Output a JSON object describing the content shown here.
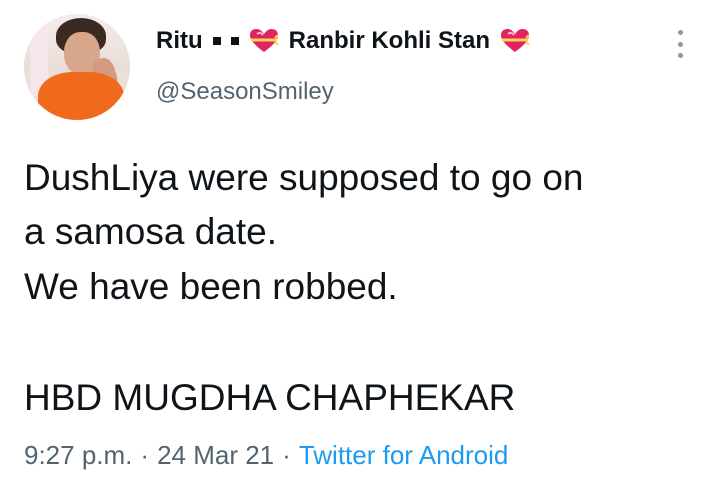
{
  "user": {
    "name_first": "Ritu",
    "name_second": "Ranbir Kohli Stan",
    "handle": "@SeasonSmiley"
  },
  "tweet": {
    "lines": [
      "DushLiya were supposed to go on",
      "a samosa date.",
      "We have been robbed.",
      "HBD MUGDHA CHAPHEKAR"
    ]
  },
  "meta": {
    "time": "9:27 p.m.",
    "separator": "·",
    "date": "24 Mar 21",
    "source": "Twitter for Android"
  },
  "icons": {
    "emoji": "heart-with-ribbon-icon",
    "menu": "more-vertical-icon"
  },
  "colors": {
    "text": "#0f1419",
    "secondary": "#536471",
    "link": "#1d9bf0",
    "heart": "#e0245e"
  }
}
